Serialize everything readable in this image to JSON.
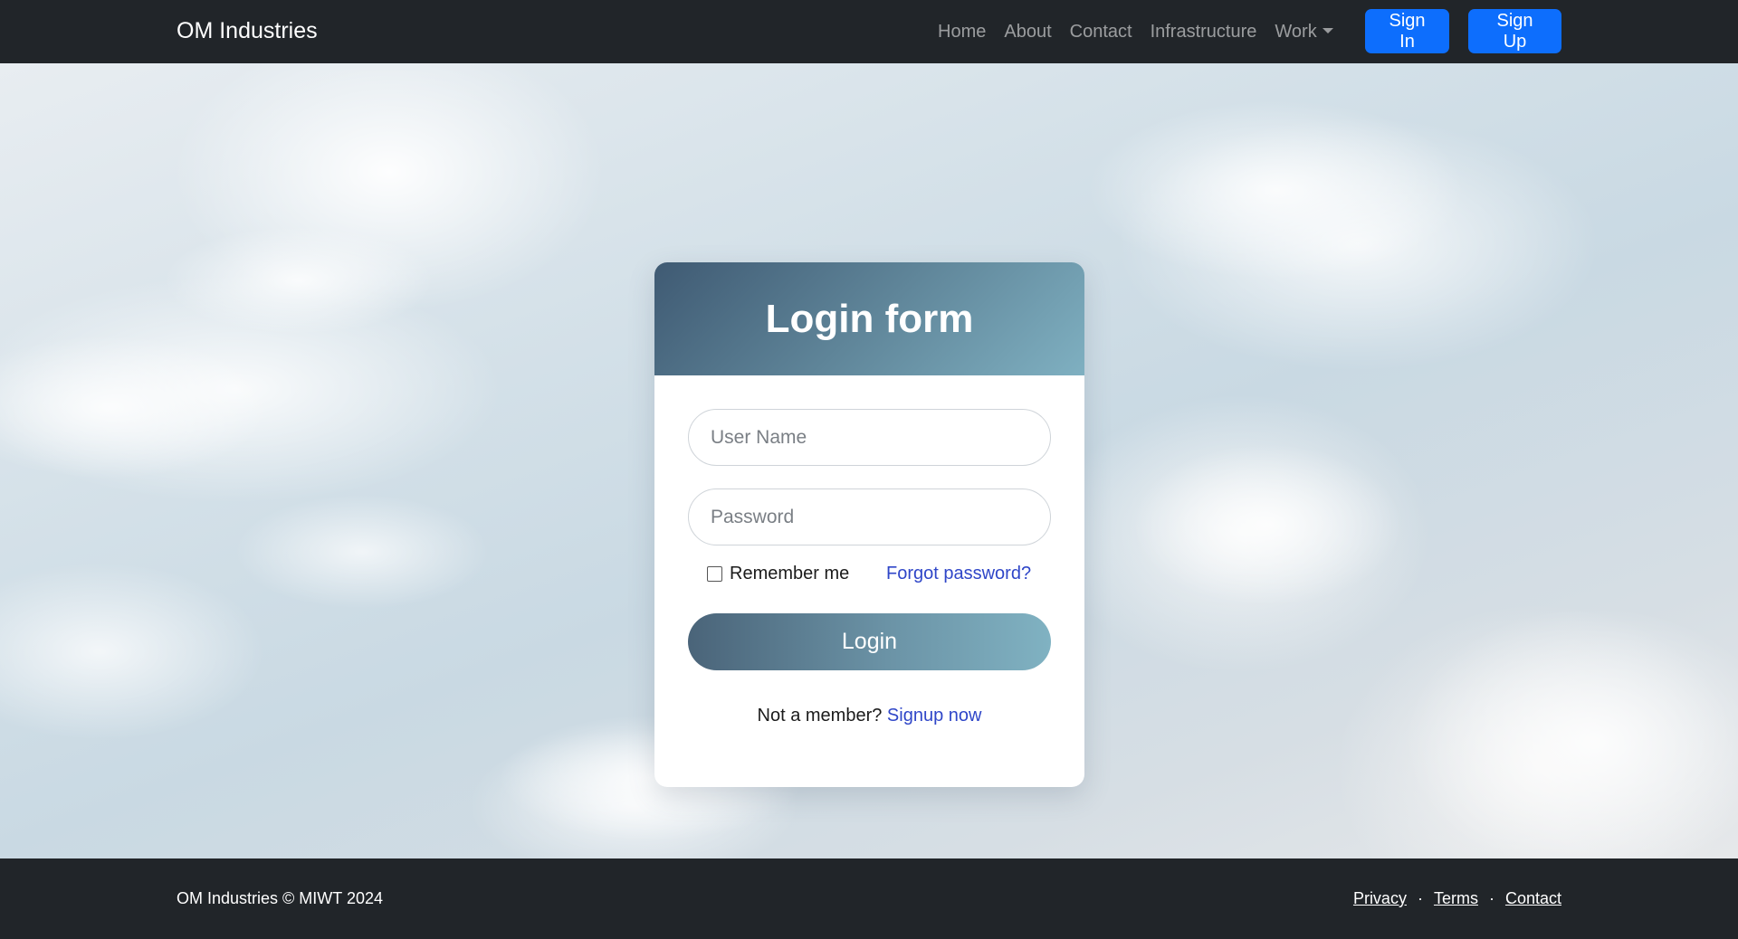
{
  "navbar": {
    "brand": "OM Industries",
    "links": [
      "Home",
      "About",
      "Contact",
      "Infrastructure",
      "Work"
    ],
    "sign_in": "Sign In",
    "sign_up": "Sign Up"
  },
  "login": {
    "title": "Login form",
    "username_placeholder": "User Name",
    "password_placeholder": "Password",
    "remember_me": "Remember me",
    "forgot_password": "Forgot password?",
    "login_button": "Login",
    "not_member": "Not a member?",
    "signup_now": "Signup now"
  },
  "footer": {
    "copyright": "OM Industries © MIWT 2024",
    "links": [
      "Privacy",
      "Terms",
      "Contact"
    ],
    "separator": "·"
  },
  "colors": {
    "navbar_bg": "#212529",
    "primary_button": "#0d6efd",
    "link": "#2f46c8",
    "header_gradient_start": "#3f5a73",
    "header_gradient_end": "#7fb0c1"
  }
}
